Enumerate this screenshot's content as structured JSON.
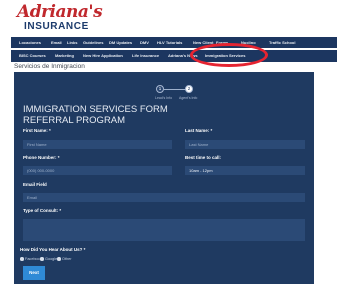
{
  "brand": {
    "script_text": "Adriana's",
    "plain_text": "INSURANCE"
  },
  "nav_primary": [
    "Locaciones",
    "Email",
    "Links",
    "Guidelines",
    "DM Updates",
    "DMV",
    "HLV Tutorials",
    "New Client",
    "Forms",
    "Nuclino",
    "Traffic School"
  ],
  "nav_secondary": [
    "BISC Courses",
    "Marketing",
    "New Hire Application",
    "Life Insurance",
    "Adriana's News",
    "Immigration Services"
  ],
  "page": {
    "title": "Servicios de Inmigracion"
  },
  "stepper": {
    "steps": [
      {
        "number": "1",
        "label": "Lead's Info"
      },
      {
        "number": "2",
        "label": "Agent's Info"
      }
    ]
  },
  "form": {
    "title": "IMMIGRATION SERVICES FORM REFERRAL PROGRAM",
    "first_name": {
      "label": "First Name: *",
      "placeholder": "First Name"
    },
    "last_name": {
      "label": "Last Name: *",
      "placeholder": "Last Name"
    },
    "phone": {
      "label": "Phone Number: *",
      "placeholder": "(000) 000-0000"
    },
    "best_time": {
      "label": "Best time to call:",
      "value": "10am - 12pm"
    },
    "email": {
      "label": "Email Field",
      "placeholder": "Email"
    },
    "consult": {
      "label": "Type of Consult: *"
    },
    "referral": {
      "label": "How Did You Hear About Us? *",
      "options": [
        "Facebook",
        "Google",
        "Other"
      ]
    },
    "next_label": "Next"
  },
  "colors": {
    "nav_bg": "#1c3660",
    "form_bg": "#1f3a61",
    "input_bg": "#2b4a76",
    "button_bg": "#2f8ad6",
    "brand_red": "#c0282d",
    "highlight_ring": "#e52431"
  }
}
